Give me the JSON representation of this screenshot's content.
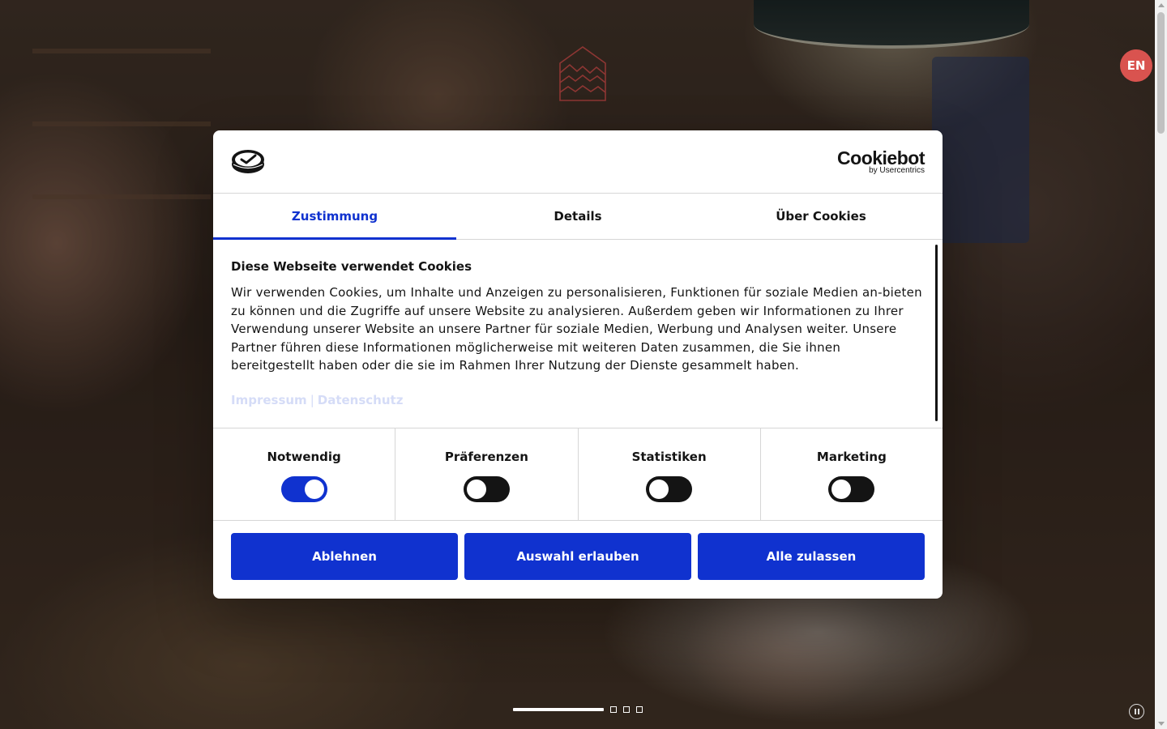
{
  "language_button": {
    "label": "EN"
  },
  "slider": {
    "slides": 4,
    "active_index": 0
  },
  "cookie_dialog": {
    "brand": "Cookiebot",
    "brand_sub": "by Usercentrics",
    "tabs": [
      {
        "label": "Zustimmung",
        "active": true
      },
      {
        "label": "Details",
        "active": false
      },
      {
        "label": "Über Cookies",
        "active": false
      }
    ],
    "title": "Diese Webseite verwendet Cookies",
    "text": "Wir verwenden Cookies, um Inhalte und Anzeigen zu personalisieren, Funktionen für soziale Medien an-bieten zu können und die Zugriffe auf unsere Website zu analysieren. Außerdem geben wir Informationen zu Ihrer Verwendung unserer Website an unsere Partner für soziale Medien, Werbung und Analysen weiter. Unsere Partner führen diese Informationen möglicherweise mit weiteren Daten zusammen, die Sie ihnen bereitgestellt haben oder die sie im Rahmen Ihrer Nutzung der Dienste gesammelt haben.",
    "links": {
      "impressum": "Impressum",
      "separator": "|",
      "datenschutz": "Datenschutz"
    },
    "toggles": [
      {
        "label": "Notwendig",
        "enabled": true
      },
      {
        "label": "Präferenzen",
        "enabled": false
      },
      {
        "label": "Statistiken",
        "enabled": false
      },
      {
        "label": "Marketing",
        "enabled": false
      }
    ],
    "buttons": {
      "decline": "Ablehnen",
      "allow_selection": "Auswahl erlauben",
      "allow_all": "Alle zulassen"
    }
  },
  "colors": {
    "accent": "#1032cf",
    "language_button": "#d9534f",
    "logo_stroke": "#d9534f"
  },
  "icons": {
    "site_logo": "mountain-house-icon",
    "brand_logo": "cookiebot-badge-icon",
    "pause": "pause-icon"
  }
}
